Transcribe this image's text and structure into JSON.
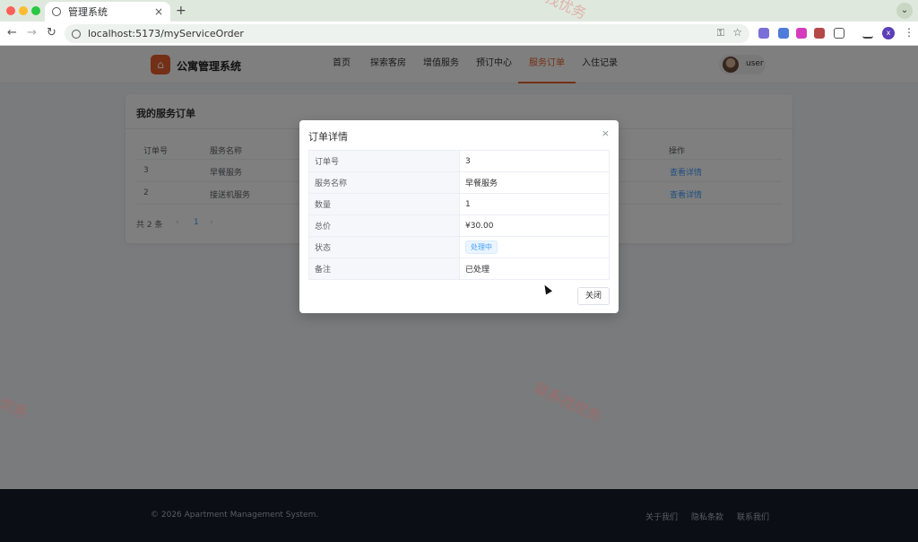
{
  "browser": {
    "tab_title": "管理系统",
    "url": "localhost:5173/myServiceOrder",
    "profile_initial": "x"
  },
  "header": {
    "brand": "公寓管理系统",
    "nav": [
      "首页",
      "探索客房",
      "增值服务",
      "预订中心",
      "服务订单",
      "入住记录"
    ],
    "active_index": 4,
    "user": "user"
  },
  "orders_card": {
    "title": "我的服务订单",
    "columns": [
      "订单号",
      "服务名称",
      "操作"
    ],
    "rows": [
      {
        "id": "3",
        "service": "早餐服务",
        "action": "查看详情"
      },
      {
        "id": "2",
        "service": "接送机服务",
        "action": "查看详情"
      }
    ],
    "total": "共 2 条",
    "page": "1",
    "prev": "‹",
    "next": "›"
  },
  "dialog": {
    "title": "订单详情",
    "close_icon": "×",
    "fields": [
      {
        "label": "订单号",
        "value": "3"
      },
      {
        "label": "服务名称",
        "value": "早餐服务"
      },
      {
        "label": "数量",
        "value": "1"
      },
      {
        "label": "总价",
        "value": "¥30.00"
      },
      {
        "label": "状态",
        "value": "处理中"
      },
      {
        "label": "备注",
        "value": "已处理"
      }
    ],
    "close_button": "关闭"
  },
  "footer": {
    "copyright": "© 2026 Apartment Management System.",
    "links": [
      "关于我们",
      "隐私条款",
      "联系我们"
    ]
  },
  "watermark": [
    "找优务",
    "联系找优务",
    "优务"
  ],
  "colors": {
    "accent": "#e8612c",
    "link": "#409eff",
    "price": "#f56c6c"
  }
}
